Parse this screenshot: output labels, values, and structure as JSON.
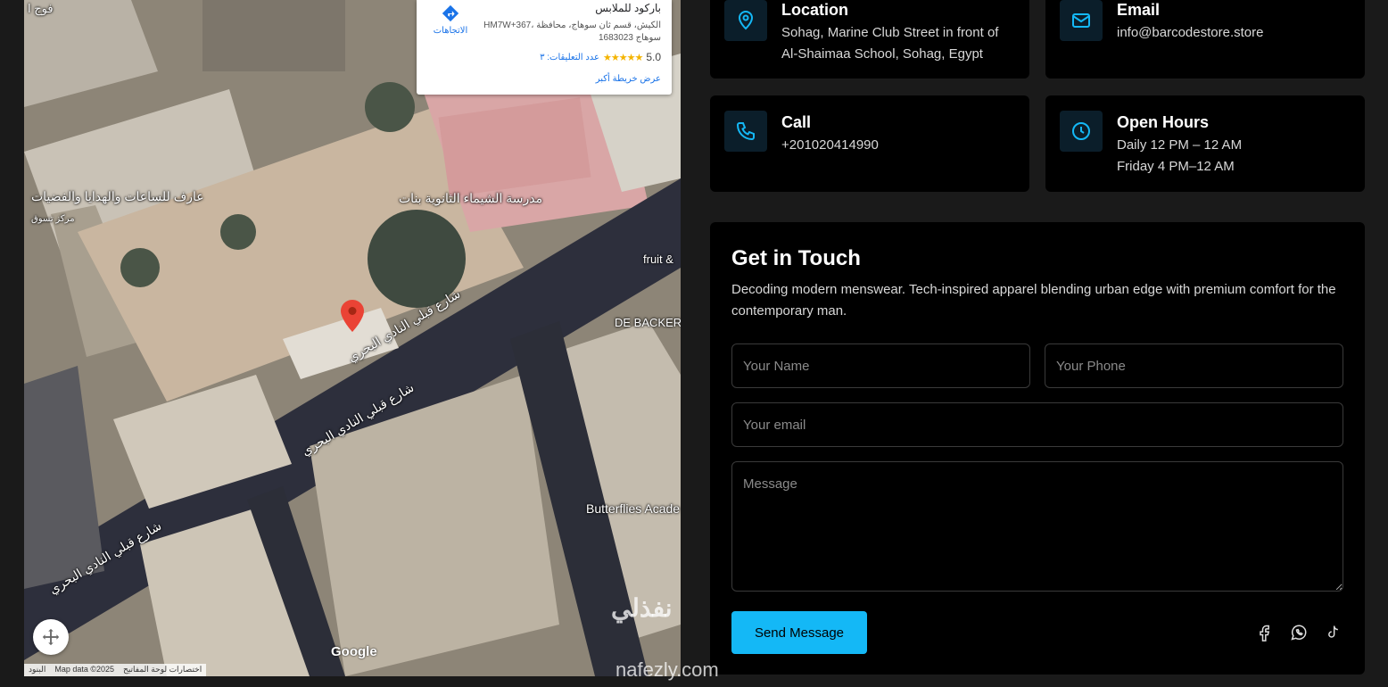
{
  "map": {
    "place_card": {
      "name": "باركود للملابس",
      "address": "HM7W+367، الكيش، قسم ثان سوهاج، محافظة سوهاج 1683023",
      "rating": "5.0",
      "stars": "★★★★★",
      "reviews": "عدد التعليقات: ٣",
      "directions_label": "الاتجاهات",
      "view_larger": "عرض خريطة أكبر"
    },
    "labels": {
      "school": "مدرسة الشيماء الثانوية بنات",
      "watches_shop": "عارف للساعات والهدايا والفضيات",
      "shopping": "مركز تسوق",
      "fruit": "fruit &",
      "debackers": "DE BACKER",
      "butterflies": "Butterflies Acade",
      "street1": "شارع قبلي النادي البحري",
      "street2": "شارع قبلي النادي البحري",
      "street3": "شارع قبلي النادي البحري",
      "corner": "فوج ا"
    },
    "google": "Google",
    "attribution": [
      "البنود",
      "Map data ©2025",
      "اختصارات لوحة المفاتيح"
    ]
  },
  "info": {
    "location": {
      "title": "Location",
      "line1": "Sohag, Marine Club Street in front of",
      "line2": "Al-Shaimaa School, Sohag, Egypt",
      "icon": "map-pin-icon"
    },
    "email": {
      "title": "Email",
      "line1": "info@barcodestore.store",
      "icon": "mail-icon"
    },
    "call": {
      "title": "Call",
      "line1": "+201020414990",
      "icon": "phone-icon"
    },
    "hours": {
      "title": "Open Hours",
      "line1": "Daily 12 PM – 12 AM",
      "line2": "Friday 4 PM–12 AM",
      "icon": "clock-icon"
    }
  },
  "form": {
    "title": "Get in Touch",
    "description": "Decoding modern menswear. Tech-inspired apparel blending urban edge with premium comfort for the contemporary man.",
    "name_placeholder": "Your Name",
    "phone_placeholder": "Your Phone",
    "email_placeholder": "Your email",
    "message_placeholder": "Message",
    "send_label": "Send Message",
    "socials": [
      "facebook-icon",
      "whatsapp-icon",
      "tiktok-icon"
    ]
  },
  "watermark": {
    "main": "نفذلي",
    "sub": "nafezly.com"
  },
  "colors": {
    "accent": "#14b8f6",
    "card_bg": "#000000",
    "page_bg": "#1a1a1a"
  }
}
